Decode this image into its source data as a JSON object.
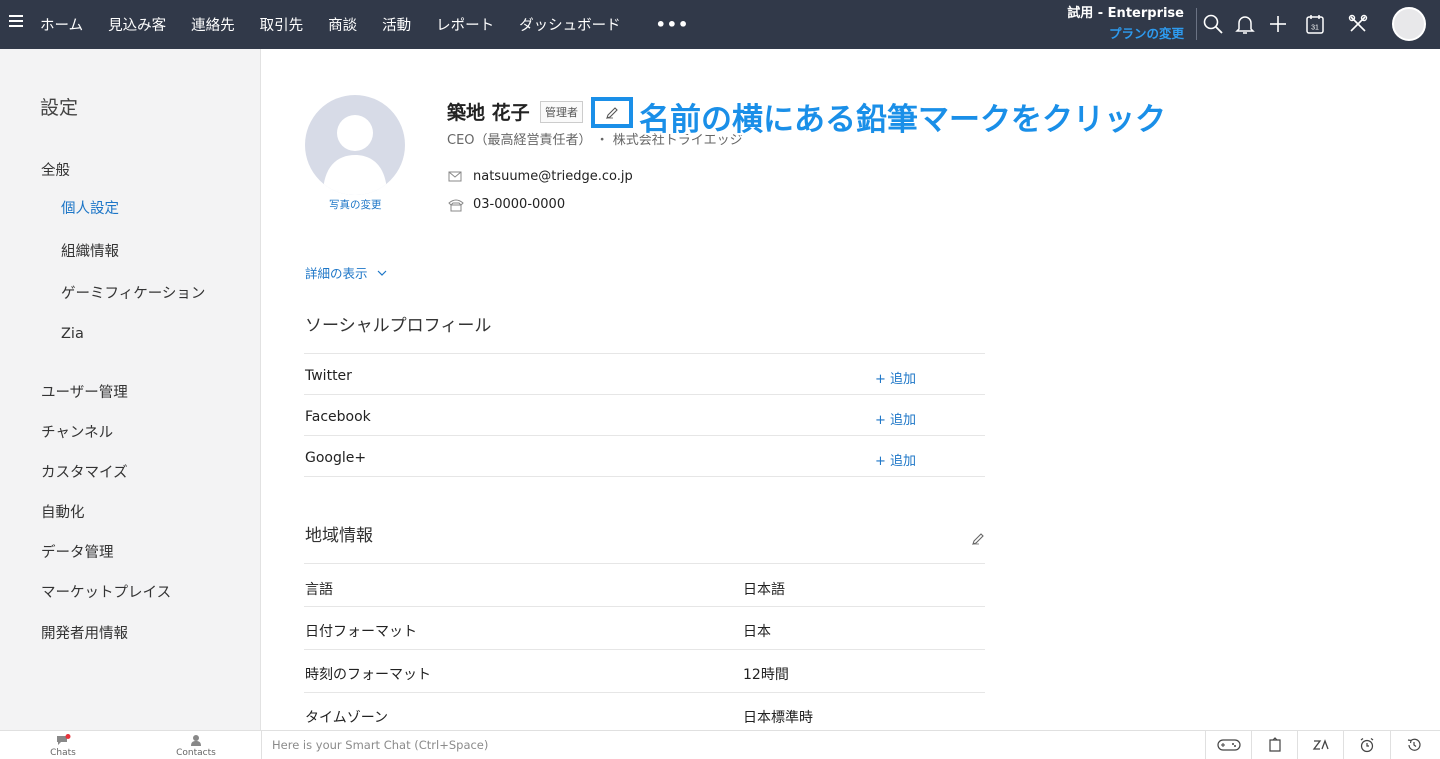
{
  "topnav": {
    "items": [
      "ホーム",
      "見込み客",
      "連絡先",
      "取引先",
      "商談",
      "活動",
      "レポート",
      "ダッシュボード"
    ],
    "more": "•••",
    "edition": "試用 - Enterprise",
    "upgrade": "プランの変更",
    "calendar_day": "31"
  },
  "sidebar": {
    "title": "設定",
    "general": "全般",
    "personal": "個人設定",
    "org": "組織情報",
    "gamification": "ゲーミフィケーション",
    "zia": "Zia",
    "users": "ユーザー管理",
    "channels": "チャンネル",
    "customize": "カスタマイズ",
    "automation": "自動化",
    "data": "データ管理",
    "marketplace": "マーケットプレイス",
    "developer": "開発者用情報"
  },
  "profile": {
    "name": "築地 花子",
    "role_badge": "管理者",
    "title_company": "CEO（最高経営責任者） ・ 株式会社トライエッジ",
    "email": "natsuume@triedge.co.jp",
    "phone": "03-0000-0000",
    "change_photo": "写真の変更",
    "callout": "名前の横にある鉛筆マークをクリック",
    "show_details": "詳細の表示"
  },
  "social": {
    "title": "ソーシャルプロフィール",
    "rows": [
      {
        "label": "Twitter",
        "action": "+ 追加"
      },
      {
        "label": "Facebook",
        "action": "+ 追加"
      },
      {
        "label": "Google+",
        "action": "+ 追加"
      }
    ]
  },
  "locale": {
    "title": "地域情報",
    "rows": [
      {
        "label": "言語",
        "value": "日本語"
      },
      {
        "label": "日付フォーマット",
        "value": "日本"
      },
      {
        "label": "時刻のフォーマット",
        "value": "12時間"
      },
      {
        "label": "タイムゾーン",
        "value": "日本標準時"
      }
    ]
  },
  "bottombar": {
    "chats": "Chats",
    "contacts": "Contacts",
    "smartchat_placeholder": "Here is your Smart Chat (Ctrl+Space)"
  }
}
